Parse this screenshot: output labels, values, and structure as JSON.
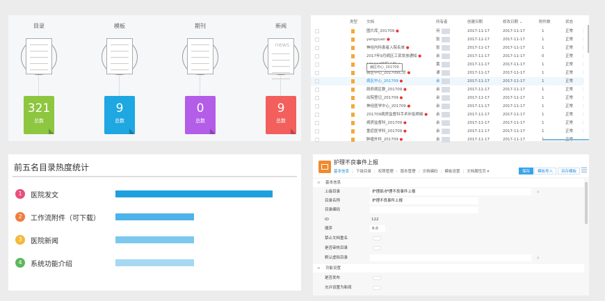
{
  "overview": {
    "items": [
      {
        "label": "目录",
        "count": "321",
        "total_label": "总数",
        "color": "#8dc63f",
        "icon": "document-icon"
      },
      {
        "label": "模板",
        "count": "9",
        "total_label": "总数",
        "color": "#1ea7e0",
        "icon": "template-icon"
      },
      {
        "label": "期刊",
        "count": "0",
        "total_label": "总数",
        "color": "#b35de8",
        "icon": "journal-icon"
      },
      {
        "label": "新闻",
        "count": "9",
        "total_label": "总数",
        "color": "#f25f5c",
        "icon": "news-icon",
        "icon_text": "news"
      }
    ]
  },
  "doc_table": {
    "headers": {
      "type": "类型",
      "doc": "文档",
      "owner": "所有者",
      "created": "创建日期",
      "modified": "修改日期 ⌄",
      "attach": "附件数",
      "status": "状态"
    },
    "tooltip": "病区中心_201709",
    "rows": [
      {
        "doc": "图片库_201709",
        "owner": "何",
        "created": "2017-11-17",
        "modified": "2017-11-17",
        "attach": "1",
        "status": "正常"
      },
      {
        "doc": "yangyuan",
        "owner": "张",
        "created": "2017-11-17",
        "modified": "2017-11-17",
        "attach": "1",
        "status": "正常"
      },
      {
        "doc": "神经内科患者入院名单",
        "owner": "张",
        "created": "2017-11-17",
        "modified": "2017-11-17",
        "attach": "1",
        "status": "正常"
      },
      {
        "doc": "2017年9月病区工资发放通知",
        "owner": "余",
        "created": "2017-11-17",
        "modified": "2017-11-17",
        "attach": "0",
        "status": "正常"
      },
      {
        "doc": "171117医院计划",
        "owner": "黄",
        "created": "2017-11-17",
        "modified": "2017-11-17",
        "attach": "1",
        "status": "正常"
      },
      {
        "doc": "病区中心_201709汇总",
        "owner": "谭",
        "created": "2017-11-17",
        "modified": "2017-11-17",
        "attach": "1",
        "status": "正常"
      },
      {
        "doc": "病区中心_201709",
        "owner": "余",
        "created": "2017-11-17",
        "modified": "2017-11-17",
        "attach": "1",
        "status": "正常",
        "highlight": true
      },
      {
        "doc": "政府病区数_201709",
        "owner": "余",
        "created": "2017-11-17",
        "modified": "2017-11-17",
        "attach": "1",
        "status": "正常"
      },
      {
        "doc": "出院登记_201709",
        "owner": "余",
        "created": "2017-11-17",
        "modified": "2017-11-17",
        "attach": "1",
        "status": "正常"
      },
      {
        "doc": "神经医学中心_201709",
        "owner": "余",
        "created": "2017-11-17",
        "modified": "2017-11-17",
        "attach": "1",
        "status": "正常"
      },
      {
        "doc": "201709病房监督科手术补贴明细",
        "owner": "余",
        "created": "2017-11-17",
        "modified": "2017-11-17",
        "attach": "1",
        "status": "正常"
      },
      {
        "doc": "病房监督科_201709",
        "owner": "余",
        "created": "2017-11-17",
        "modified": "2017-11-17",
        "attach": "1",
        "status": "正常"
      },
      {
        "doc": "重症医学科_201709",
        "owner": "余",
        "created": "2017-11-17",
        "modified": "2017-11-17",
        "attach": "1",
        "status": "正常"
      },
      {
        "doc": "肿瘤外科_201709",
        "owner": "余",
        "created": "2017-11-17",
        "modified": "2017-11-17",
        "attach": "1",
        "status": "正常"
      }
    ]
  },
  "hot": {
    "title": "前五名目录热度统计",
    "items": [
      {
        "rank": "1",
        "label": "医院发文",
        "value": 1.0,
        "color": "#e94f7a",
        "bar": "#1fa0de"
      },
      {
        "rank": "2",
        "label": "工作流附件（可下载）",
        "value": 0.5,
        "color": "#f07e3e",
        "bar": "#4db3e8"
      },
      {
        "rank": "3",
        "label": "医院新闻",
        "value": 0.5,
        "color": "#f5b93a",
        "bar": "#7cc8ee"
      },
      {
        "rank": "4",
        "label": "系统功能介绍",
        "value": 0.5,
        "color": "#5cb85c",
        "bar": "#a5d8f2"
      }
    ]
  },
  "editor": {
    "title": "护理不良事件上报",
    "tabs": [
      "基本信息",
      "下级目录",
      "权限管理",
      "版本管理",
      "文档编码",
      "模板设置",
      "文档属性页 ▾"
    ],
    "buttons": {
      "save": "保存",
      "import": "模板导入",
      "save_as": "另存模板"
    },
    "section_basic": "基本信息",
    "fields": {
      "parent_label": "上级目录",
      "parent_value": "护理部/护理不良事件上报",
      "name_label": "目录名称",
      "name_value": "护理不良事件上报",
      "code_label": "目录编码",
      "code_value": "",
      "id_label": "ID",
      "id_value": "122",
      "order_label": "顺序",
      "order_value": "0.0",
      "no_dup_label": "禁止文档重名",
      "audit_label": "是否审核目录",
      "virtual_label": "默认虚拟目录"
    },
    "section_func": "功能设置",
    "func": {
      "publish_label": "是否发布",
      "news_label": "允许设置为新闻"
    }
  }
}
